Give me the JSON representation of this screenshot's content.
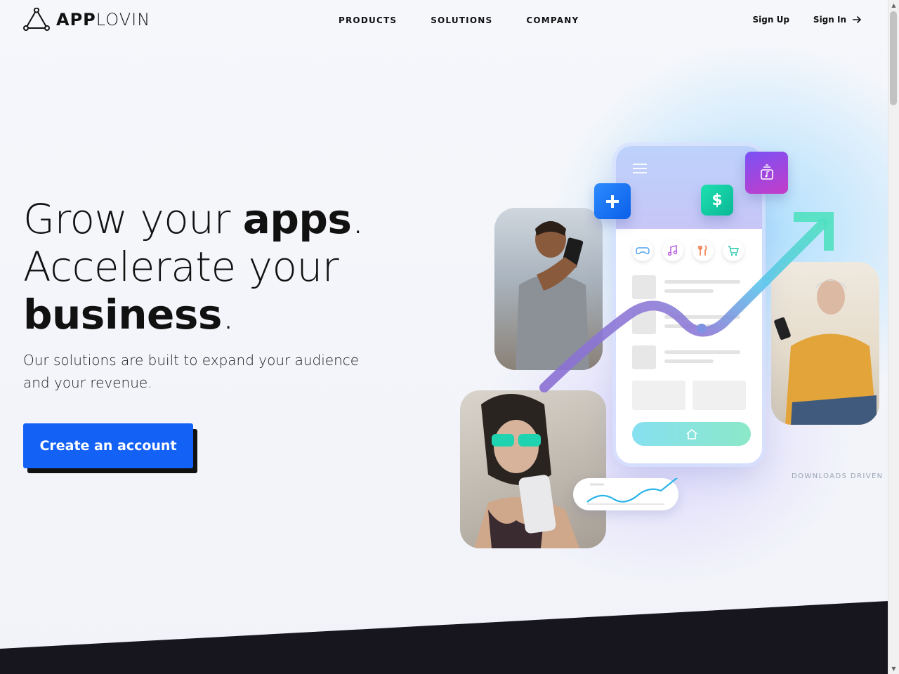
{
  "header": {
    "logo": {
      "bold": "APP",
      "light": "LOVIN"
    },
    "nav": [
      "PRODUCTS",
      "SOLUTIONS",
      "COMPANY"
    ],
    "sign_up": "Sign Up",
    "sign_in": "Sign In"
  },
  "hero": {
    "line1_pre": "Grow your ",
    "line1_bold": "apps",
    "line1_post": ".",
    "line2": "Accelerate your",
    "line3_bold": "business",
    "line3_post": ".",
    "subhead": "Our solutions are built to expand your audience and your revenue.",
    "cta": "Create an account"
  },
  "illustration": {
    "caption": "DOWNLOADS DRIVEN",
    "tiles": [
      "plus-icon",
      "dollar-icon",
      "music-icon"
    ],
    "dollar_label": "$",
    "app_icons": [
      "gamepad-icon",
      "music-note-icon",
      "fork-knife-icon",
      "cart-icon"
    ]
  },
  "colors": {
    "accent": "#1462f5",
    "footer_band": "#17161f",
    "trend_purple": "#8a6fd4",
    "trend_cyan": "#4fd0e8"
  }
}
